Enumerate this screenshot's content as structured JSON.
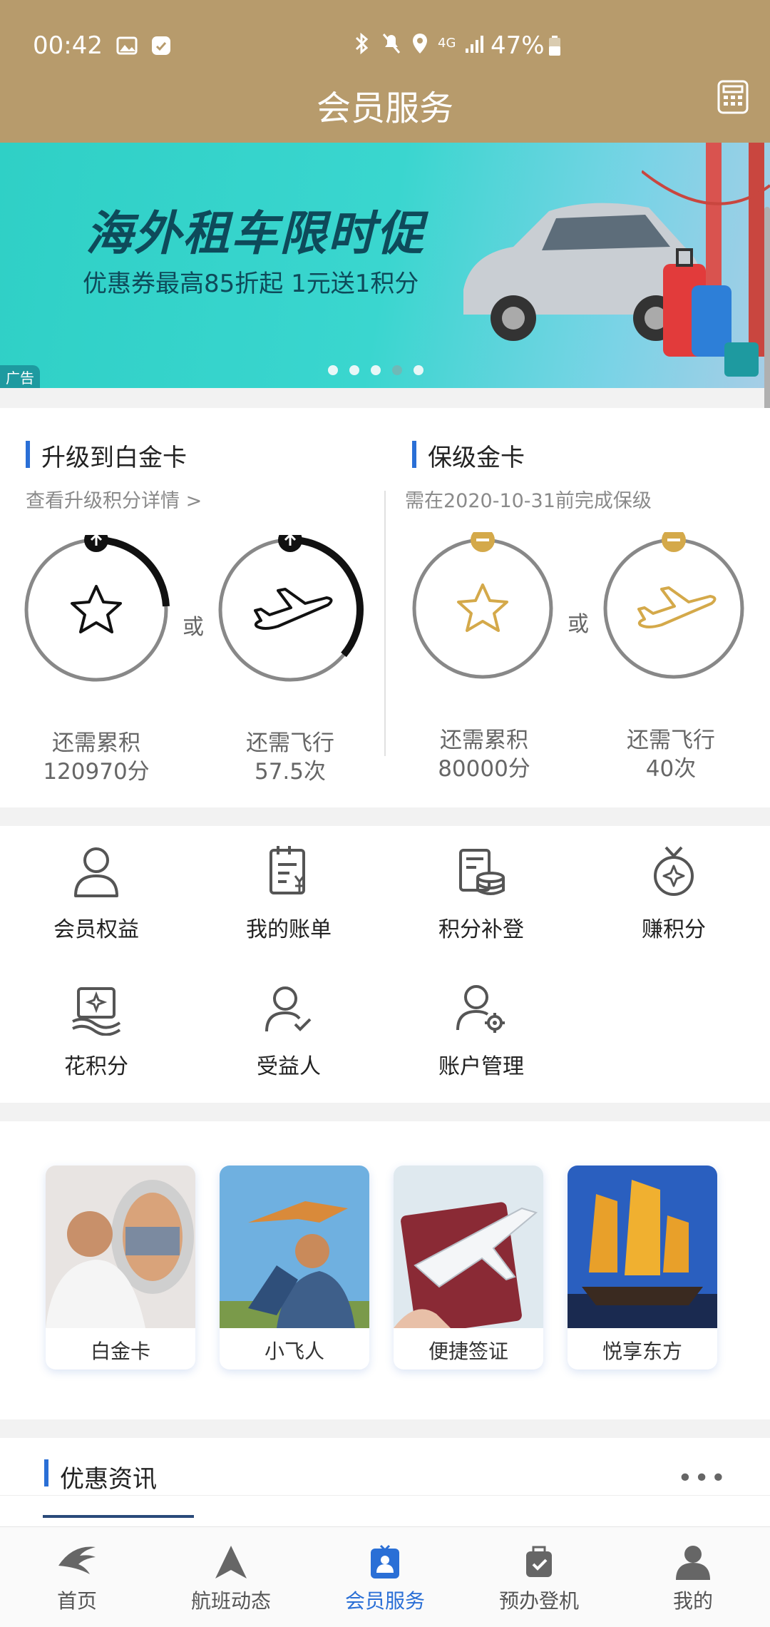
{
  "status_bar": {
    "time": "00:42",
    "network": "4G",
    "battery": "47%"
  },
  "header": {
    "title": "会员服务"
  },
  "banner": {
    "headline": "海外租车限时促",
    "subtitle": "优惠券最高85折起  1元送1积分",
    "ad_tag": "广告",
    "dots": 5,
    "active_dot": 4
  },
  "upgrade": {
    "title": "升级到白金卡",
    "link": "查看升级积分详情 >",
    "left": {
      "label": "还需累积",
      "value": "120970分",
      "progress": 0.22
    },
    "or": "或",
    "right": {
      "label": "还需飞行",
      "value": "57.5次",
      "progress": 0.36
    }
  },
  "retain": {
    "title": "保级金卡",
    "subtitle": "需在2020-10-31前完成保级",
    "left": {
      "label": "还需累积",
      "value": "80000分",
      "progress": 0
    },
    "or": "或",
    "right": {
      "label": "还需飞行",
      "value": "40次",
      "progress": 0
    }
  },
  "services": [
    {
      "label": "会员权益",
      "icon": "person-icon"
    },
    {
      "label": "我的账单",
      "icon": "bill-icon"
    },
    {
      "label": "积分补登",
      "icon": "coins-icon"
    },
    {
      "label": "赚积分",
      "icon": "medal-icon"
    },
    {
      "label": "花积分",
      "icon": "spend-points-icon"
    },
    {
      "label": "受益人",
      "icon": "beneficiary-icon"
    },
    {
      "label": "账户管理",
      "icon": "account-settings-icon"
    }
  ],
  "privileges": [
    {
      "label": "白金卡"
    },
    {
      "label": "小飞人"
    },
    {
      "label": "便捷签证"
    },
    {
      "label": "悦享东方"
    }
  ],
  "news": {
    "title": "优惠资讯",
    "more": "•••"
  },
  "bottom_nav": [
    {
      "label": "首页",
      "icon": "home-swallow-icon"
    },
    {
      "label": "航班动态",
      "icon": "flight-status-icon"
    },
    {
      "label": "会员服务",
      "icon": "member-service-icon",
      "active": true
    },
    {
      "label": "预办登机",
      "icon": "checkin-icon"
    },
    {
      "label": "我的",
      "icon": "profile-icon"
    }
  ],
  "colors": {
    "header": "#b79b6c",
    "accent": "#2a6fd6",
    "gold": "#d4a94a"
  }
}
